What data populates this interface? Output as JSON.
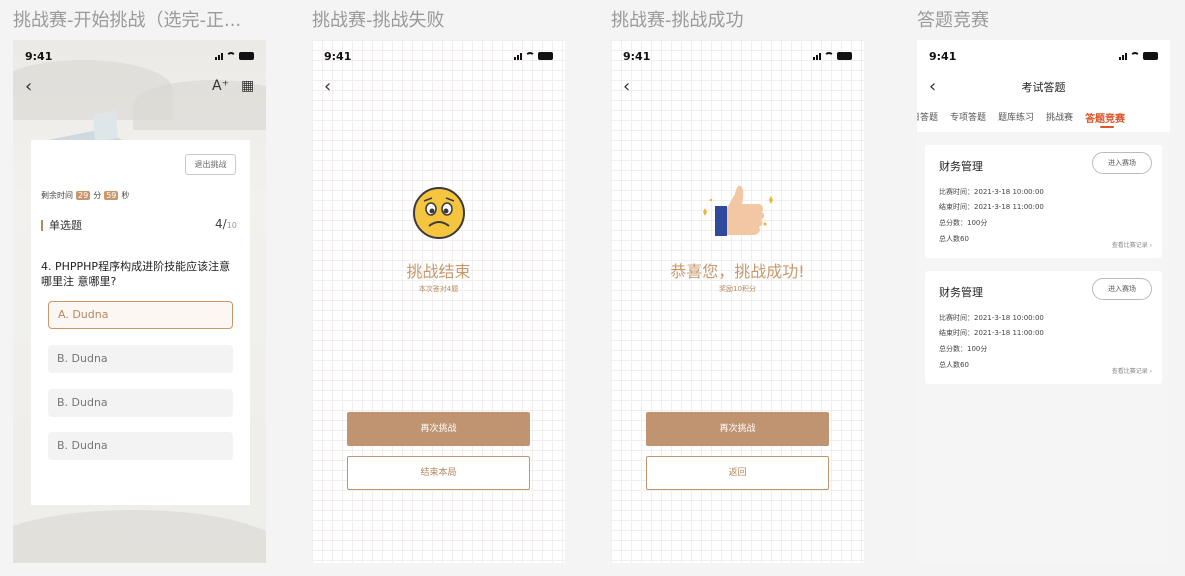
{
  "frames": [
    {
      "title": "挑战赛-开始挑战（选完-正..."
    },
    {
      "title": "挑战赛-挑战失败"
    },
    {
      "title": "挑战赛-挑战成功"
    },
    {
      "title": "答题竞赛"
    }
  ],
  "status": {
    "time": "9:41"
  },
  "icons": {
    "back": "‹",
    "font": "A⁺",
    "grid": "▦"
  },
  "challenge": {
    "exit_label": "退出挑战",
    "timer_prefix": "剩余时间",
    "minutes": "29",
    "minute_unit": "分",
    "seconds": "59",
    "second_unit": "秒",
    "qtype": "单选题",
    "current": "4/",
    "total": "10",
    "question": "4. PHPPHP程序构成进阶技能应该注意哪里注  意哪里?",
    "options": [
      "A. Dudna",
      "B. Dudna",
      "B. Dudna",
      "B. Dudna"
    ],
    "selected_index": 0
  },
  "fail": {
    "title": "挑战结束",
    "subtitle": "本次答对4题",
    "retry": "再次挑战",
    "end": "结束本局"
  },
  "success": {
    "title": "恭喜您，挑战成功!",
    "subtitle": "奖励10积分",
    "retry": "再次挑战",
    "back": "返回"
  },
  "contest": {
    "title": "考试答题",
    "tabs": [
      "日答题",
      "专项答题",
      "题库练习",
      "挑战赛",
      "答题竞赛"
    ],
    "active_tab": 4,
    "cards": [
      {
        "name": "财务管理",
        "enter": "进入赛场",
        "start": "比赛时间：2021-3-18  10:00:00",
        "end": "结束时间：2021-3-18  11:00:00",
        "score": "总分数：100分",
        "people": "总人数60",
        "record": "查看比赛记录 ›"
      },
      {
        "name": "财务管理",
        "enter": "进入赛场",
        "start": "比赛时间：2021-3-18  10:00:00",
        "end": "结束时间：2021-3-18  11:00:00",
        "score": "总分数：100分",
        "people": "总人数60",
        "record": "查看比赛记录 ›"
      }
    ]
  },
  "colors": {
    "accent": "#c09470",
    "active_tab": "#d9572d"
  }
}
